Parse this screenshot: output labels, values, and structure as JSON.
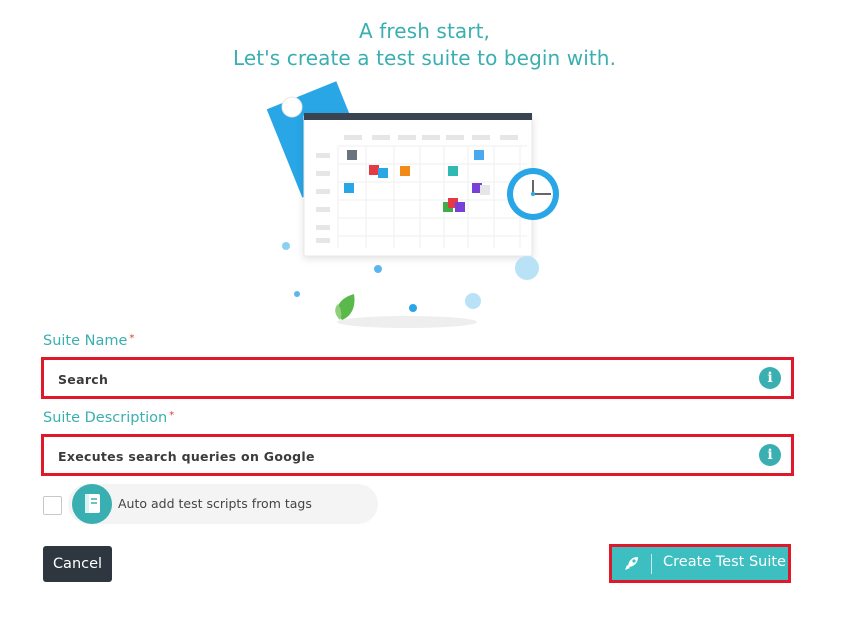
{
  "header": {
    "line1": "A fresh start,",
    "line2": "Let's create a test suite to begin with."
  },
  "suite_name": {
    "label": "Suite Name",
    "required_mark": "*",
    "value": "Search"
  },
  "suite_description": {
    "label": "Suite Description",
    "required_mark": "*",
    "value": "Executes search queries on Google"
  },
  "auto_add": {
    "label": "Auto add test scripts from tags",
    "checked": false,
    "icon": "book-icon"
  },
  "actions": {
    "cancel_label": "Cancel",
    "create_label": "Create Test Suite",
    "create_icon": "rocket-icon"
  },
  "colors": {
    "accent": "#3aafb1",
    "button_primary": "#3dbfc1",
    "button_dark": "#2e3640",
    "highlight_border": "#e0192a"
  }
}
